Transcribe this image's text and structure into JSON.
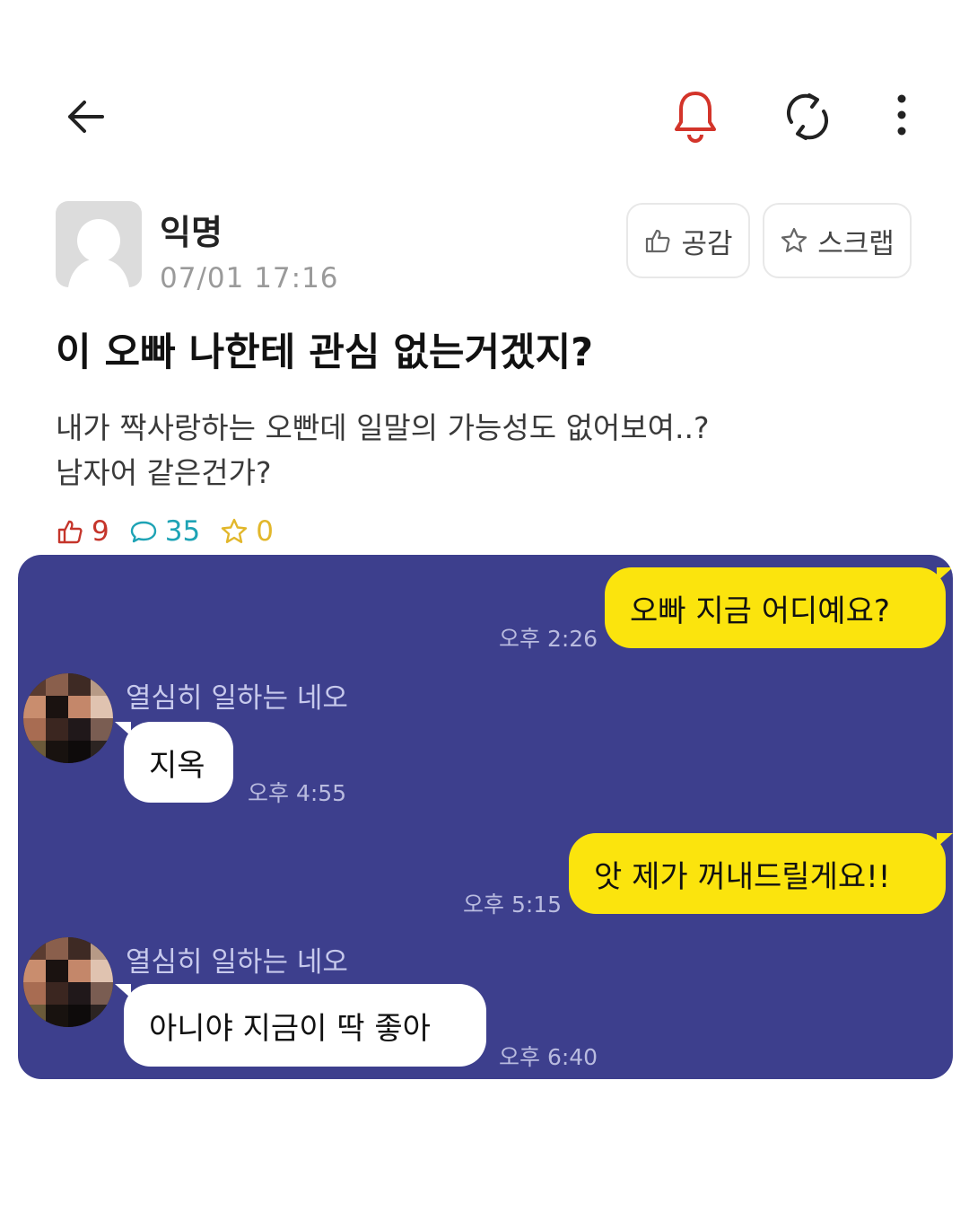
{
  "topbar": {
    "icons": [
      "back-arrow-icon",
      "bell-icon",
      "refresh-icon",
      "more-vertical-icon"
    ],
    "bell_color": "#d3342a"
  },
  "post": {
    "author": "익명",
    "time": "07/01 17:16",
    "like_button_label": "공감",
    "scrap_button_label": "스크랩",
    "title": "이 오빠 나한테 관심 없는거겠지?",
    "body_lines": [
      "내가 짝사랑하는 오빤데 일말의 가능성도 없어보여..?",
      "남자어 같은건가?"
    ],
    "stats": {
      "likes": "9",
      "comments": "35",
      "scraps": "0"
    }
  },
  "chat": {
    "background": "#3d3f8d",
    "messages": [
      {
        "side": "out",
        "text": "오빠 지금 어디예요?",
        "time": "오후 2:26"
      },
      {
        "side": "in",
        "sender": "열심히 일하는 네오",
        "text": "지옥",
        "time": "오후 4:55"
      },
      {
        "side": "out",
        "text": "앗 제가 꺼내드릴게요!!",
        "time": "오후 5:15"
      },
      {
        "side": "in",
        "sender": "열심히 일하는 네오",
        "text": "아니야 지금이 딱 좋아",
        "time": "오후 6:40"
      }
    ]
  },
  "colors": {
    "out_bubble": "#fbe40d",
    "in_bubble": "#ffffff",
    "like": "#c5352b",
    "comment": "#1ea3b5",
    "scrap": "#e2b72b"
  }
}
